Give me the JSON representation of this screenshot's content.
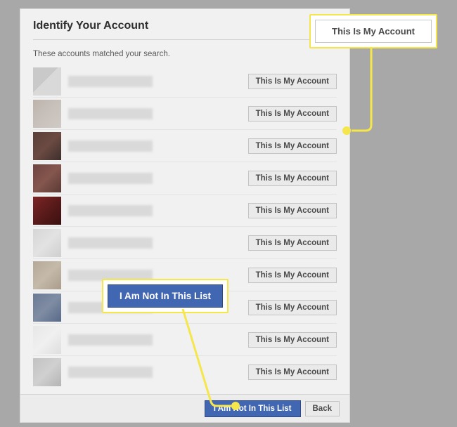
{
  "header": {
    "title": "Identify Your Account",
    "subtitle": "These accounts matched your search."
  },
  "results": {
    "button_label": "This Is My Account",
    "rows": [
      {
        "avatar": "a"
      },
      {
        "avatar": "b"
      },
      {
        "avatar": "c"
      },
      {
        "avatar": "d"
      },
      {
        "avatar": "e"
      },
      {
        "avatar": "f"
      },
      {
        "avatar": "g"
      },
      {
        "avatar": "h"
      },
      {
        "avatar": "i"
      },
      {
        "avatar": "j"
      }
    ]
  },
  "footer": {
    "not_in_list_label": "I Am Not In This List",
    "back_label": "Back"
  },
  "callouts": {
    "top_label": "This Is My Account",
    "mid_label": "I Am Not In This List"
  }
}
